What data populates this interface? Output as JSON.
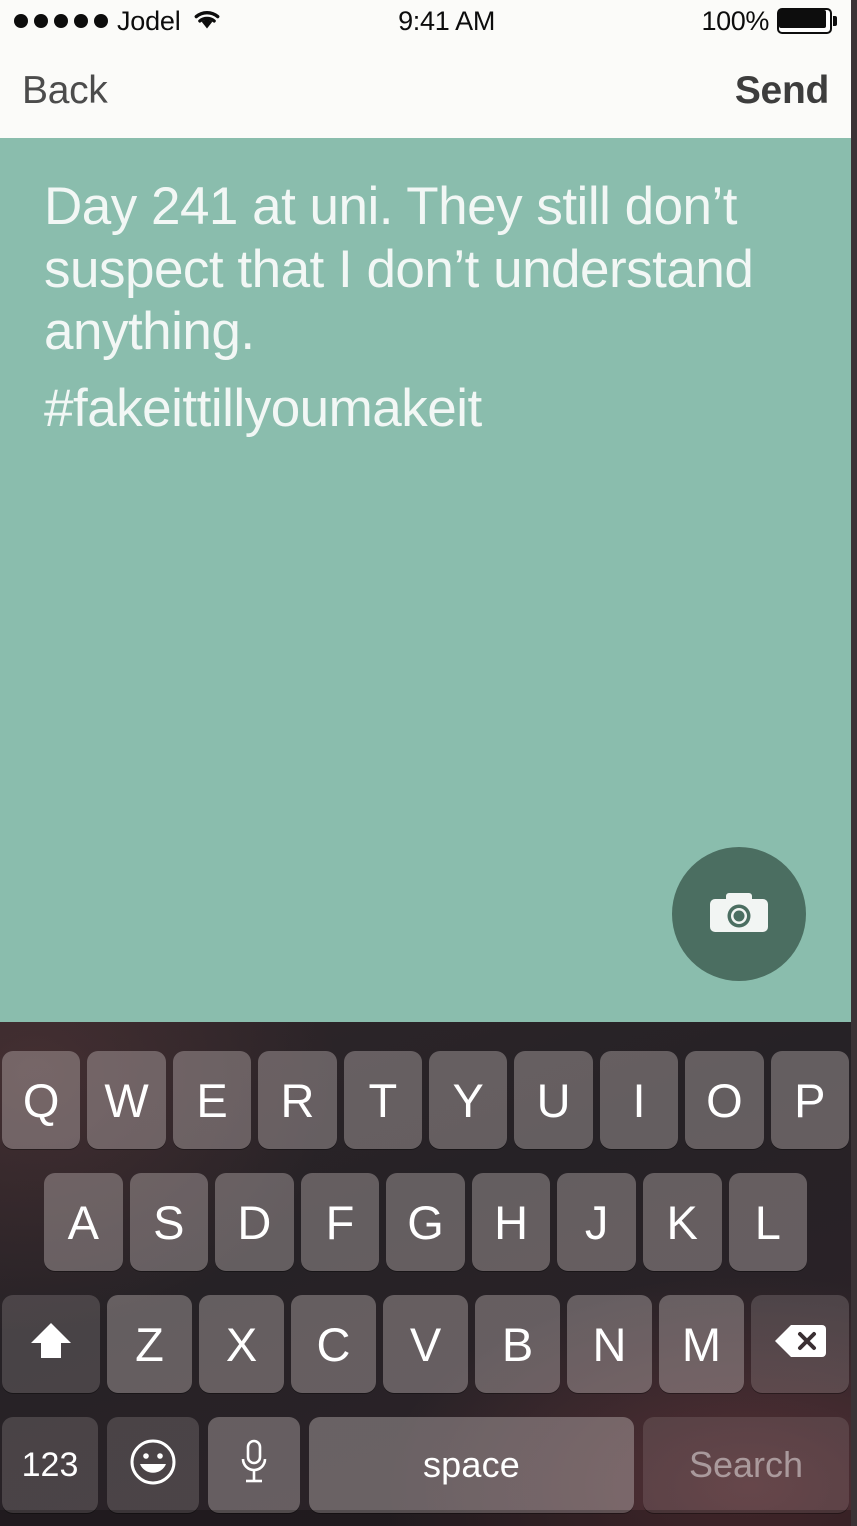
{
  "status_bar": {
    "signal_dots": 5,
    "carrier": "Jodel",
    "wifi_icon": "wifi-icon",
    "time": "9:41 AM",
    "battery_percent": "100%",
    "battery_icon": "battery-full-icon"
  },
  "nav_bar": {
    "back_label": "Back",
    "send_label": "Send"
  },
  "compose": {
    "body_text": "Day 241 at uni. They still don’t suspect that I don’t understand anything.",
    "hashtag_text": "#fakeittillyoumakeit",
    "background_color": "#8abdad",
    "text_color": "#f2f7f5",
    "camera_button_icon": "camera-icon",
    "camera_button_color": "#4b6e61"
  },
  "keyboard": {
    "row1": [
      "Q",
      "W",
      "E",
      "R",
      "T",
      "Y",
      "U",
      "I",
      "O",
      "P"
    ],
    "row2": [
      "A",
      "S",
      "D",
      "F",
      "G",
      "H",
      "J",
      "K",
      "L"
    ],
    "row3_letters": [
      "Z",
      "X",
      "C",
      "V",
      "B",
      "N",
      "M"
    ],
    "shift_icon": "shift-arrow-icon",
    "backspace_icon": "backspace-icon",
    "numeric_label": "123",
    "emoji_icon": "emoji-smiley-icon",
    "mic_icon": "microphone-icon",
    "space_label": "space",
    "search_label": "Search"
  }
}
